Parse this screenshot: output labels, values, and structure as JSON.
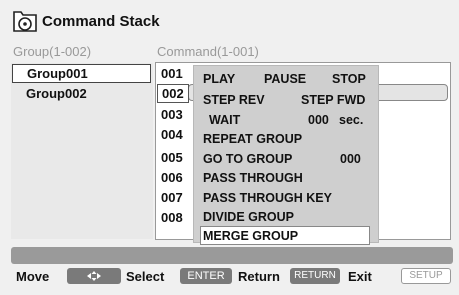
{
  "title": "Command Stack",
  "group_header": "Group(1-002)",
  "command_header": "Command(1-001)",
  "groups": [
    "Group001",
    "Group002"
  ],
  "rows": [
    "001",
    "002",
    "003",
    "004",
    "005",
    "006",
    "007",
    "008"
  ],
  "menu": {
    "play": "PLAY",
    "pause": "PAUSE",
    "stop": "STOP",
    "step_rev": "STEP REV",
    "step_fwd": "STEP FWD",
    "wait": "WAIT",
    "wait_value": "000",
    "wait_unit": "sec.",
    "repeat_group": "REPEAT GROUP",
    "go_to_group": "GO TO GROUP",
    "go_to_value": "000",
    "pass_through": "PASS THROUGH",
    "pass_through_key": "PASS THROUGH KEY",
    "divide_group": "DIVIDE GROUP",
    "merge_group": "MERGE GROUP"
  },
  "footer": {
    "move": "Move",
    "select": "Select",
    "enter_key": "ENTER",
    "return": "Return",
    "return_key": "RETURN",
    "exit": "Exit",
    "setup_key": "SETUP"
  }
}
